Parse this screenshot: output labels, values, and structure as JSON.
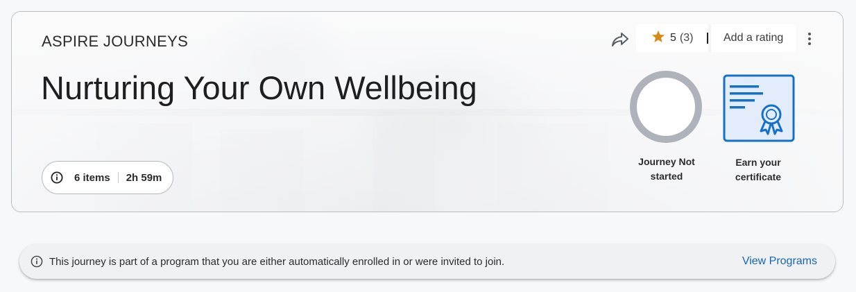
{
  "hero": {
    "eyebrow": "ASPIRE JOURNEYS",
    "title": "Nurturing Your Own Wellbeing",
    "meta": {
      "items": "6 items",
      "duration": "2h 59m"
    },
    "rating": {
      "value": "5",
      "count": "(3)",
      "add_label": "Add a rating"
    },
    "progress": {
      "status_label": "Journey Not started",
      "fraction": 0
    },
    "certificate": {
      "label": "Earn your certificate"
    }
  },
  "notice": {
    "text": "This journey is part of a program that you are either automatically enrolled in or were invited to join.",
    "action_label": "View Programs"
  },
  "colors": {
    "accent_blue": "#1565c0",
    "star": "#d88a14",
    "ring_gray": "#aeb3bb",
    "cert_blue": "#1570c9"
  },
  "icons": {
    "share": "share-icon",
    "star": "star-icon",
    "more": "more-vertical-icon",
    "info": "info-icon",
    "certificate": "certificate-icon"
  }
}
